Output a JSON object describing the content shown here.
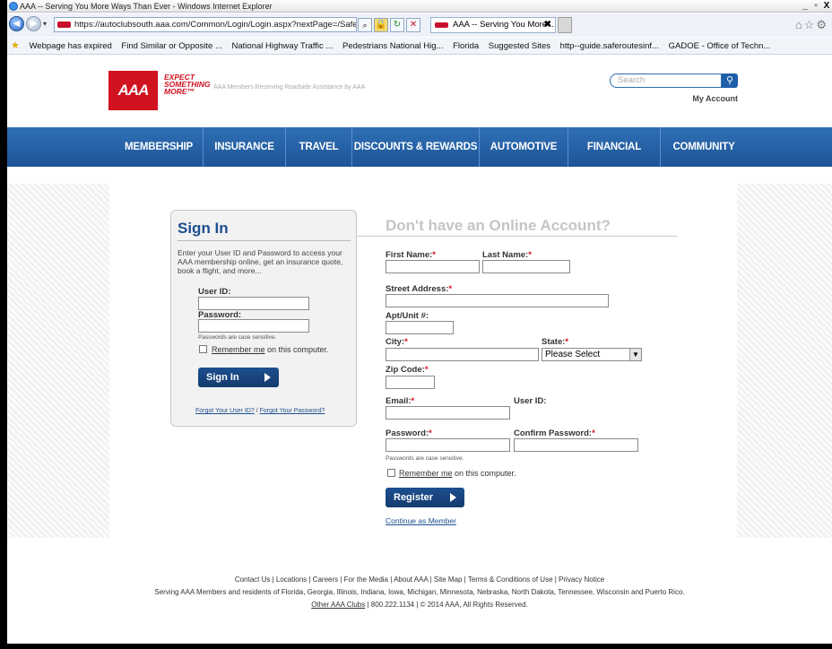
{
  "browser": {
    "window_title": "AAA -- Serving You More Ways Than Ever - Windows Internet Explorer",
    "url": "https://autoclubsouth.aaa.com/Common/Login/Login.aspx?nextPage=/Safety.",
    "tab_title": "AAA -- Serving You More ...",
    "favorites": [
      "Webpage has expired",
      "Find Similar or Opposite ...",
      "National Highway Traffic ...",
      "Pedestrians National Hig...",
      "Florida",
      "Suggested Sites",
      "http--guide.saferoutesinf...",
      "GADOE - Office of Techn..."
    ]
  },
  "header": {
    "logo_text": "AAA",
    "tagline": [
      "EXPECT",
      "SOMETHING",
      "MORE™"
    ],
    "top_note": "AAA Members Receiving Roadside Assistance by AAA",
    "search_placeholder": "Search",
    "my_account": "My Account"
  },
  "nav": [
    {
      "label": "MEMBERSHIP"
    },
    {
      "label": "INSURANCE"
    },
    {
      "label": "TRAVEL"
    },
    {
      "label": "DISCOUNTS & REWARDS"
    },
    {
      "label": "AUTOMOTIVE"
    },
    {
      "label": "FINANCIAL"
    },
    {
      "label": "COMMUNITY"
    }
  ],
  "signin": {
    "title": "Sign In",
    "intro": "Enter your User ID and Password to access your AAA membership online, get an insurance quote, book a flight, and more...",
    "user_id_label": "User ID:",
    "password_label": "Password:",
    "case_note": "Passwords are case sensitive.",
    "remember_link": "Remember me",
    "remember_rest": " on this computer.",
    "button": "Sign In",
    "forgot_user": "Forgot Your User ID?",
    "forgot_sep": " / ",
    "forgot_password": "Forgot Your Password?"
  },
  "register": {
    "title": "Don't have an Online Account?",
    "first_name": "First Name:",
    "last_name": "Last Name:",
    "street": "Street Address:",
    "apt": "Apt/Unit #:",
    "city": "City:",
    "state": "State:",
    "state_selected": "Please Select",
    "zip": "Zip Code:",
    "email": "Email:",
    "user_id": "User ID:",
    "password": "Password:",
    "confirm_password": "Confirm Password:",
    "case_note": "Passwords are case sensitive.",
    "remember_link": "Remember me",
    "remember_rest": " on this computer.",
    "button": "Register",
    "continue": "Continue as Member",
    "required_mark": "*"
  },
  "footer": {
    "links": "Contact Us  |  Locations  |  Careers  |  For the Media  |  About AAA  |  Site Map  |  Terms & Conditions of Use  |  Privacy Notice",
    "serving": "Serving AAA Members and residents of Florida, Georgia, Illinois, Indiana, Iowa, Michigan, Minnesota, Nebraska, North Dakota, Tennessee, Wisconsin and Puerto Rico.",
    "other_clubs": "Other AAA Clubs",
    "phone_copy": "  |  800.222.1134  |  © 2014 AAA, All Rights Reserved."
  }
}
